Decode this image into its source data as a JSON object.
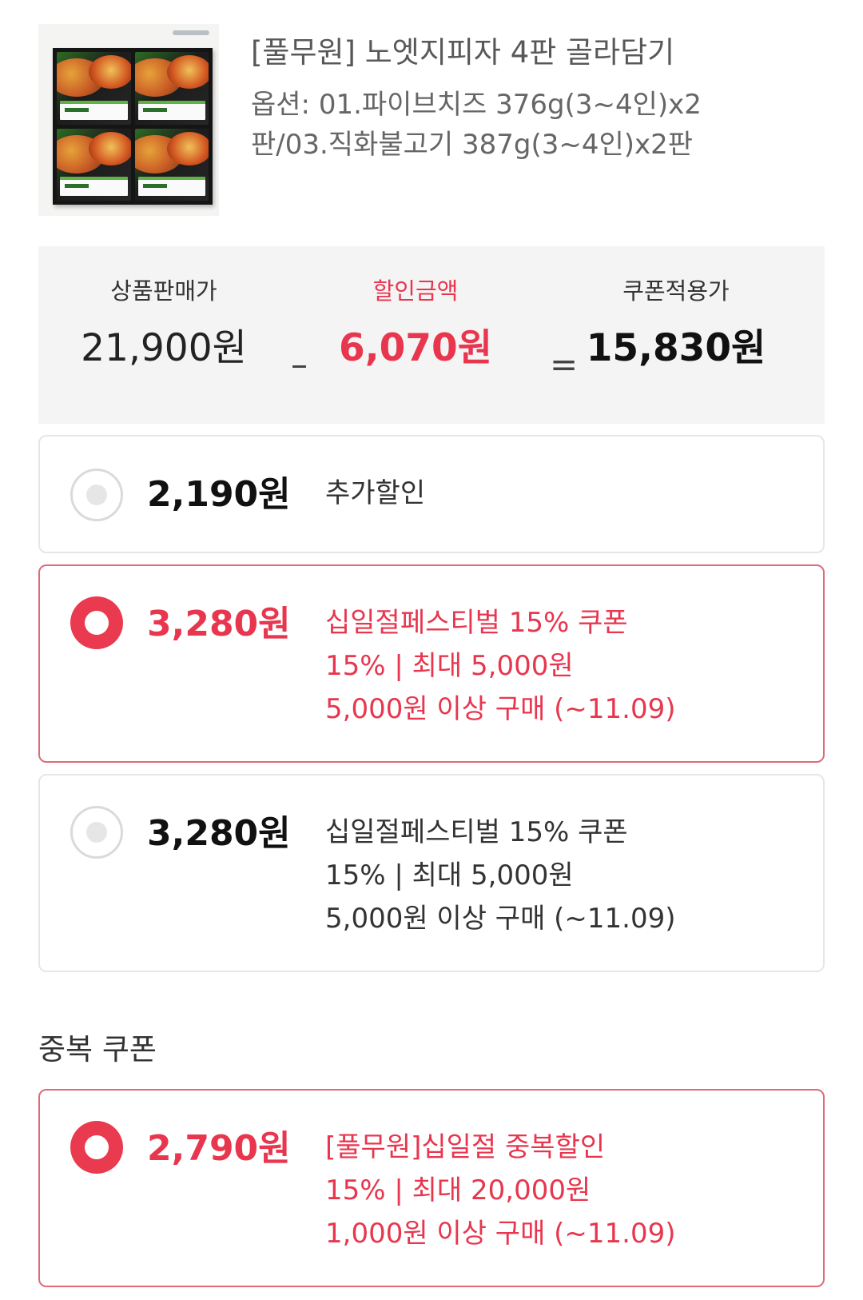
{
  "product": {
    "title": "[풀무원] 노엣지피자 4판 골라담기",
    "option": "옵션: 01.파이브치즈 376g(3~4인)x2판/03.직화불고기 387g(3~4인)x2판",
    "image_icon": "pizza-product-image"
  },
  "summary": {
    "price_label": "상품판매가",
    "price_value": "21,900원",
    "minus_symbol": "–",
    "discount_label": "할인금액",
    "discount_value": "6,070원",
    "equal_symbol": "=",
    "final_label": "쿠폰적용가",
    "final_value": "15,830원"
  },
  "coupons": [
    {
      "amount": "2,190원",
      "lines": [
        "추가할인"
      ],
      "selected": false
    },
    {
      "amount": "3,280원",
      "lines": [
        "십일절페스티벌 15% 쿠폰",
        "15% | 최대 5,000원",
        "5,000원 이상 구매 (~11.09)"
      ],
      "selected": true
    },
    {
      "amount": "3,280원",
      "lines": [
        "십일절페스티벌 15% 쿠폰",
        "15% | 최대 5,000원",
        "5,000원 이상 구매 (~11.09)"
      ],
      "selected": false
    }
  ],
  "duplicate": {
    "section_title": "중복 쿠폰",
    "coupons": [
      {
        "amount": "2,790원",
        "lines": [
          "[풀무원]십일절 중복할인",
          "15% | 최대 20,000원",
          "1,000원 이상 구매 (~11.09)"
        ],
        "selected": true
      }
    ]
  },
  "colors": {
    "accent": "#e8364e",
    "selected_border": "#e06a78",
    "summary_bg": "#f4f4f4"
  }
}
